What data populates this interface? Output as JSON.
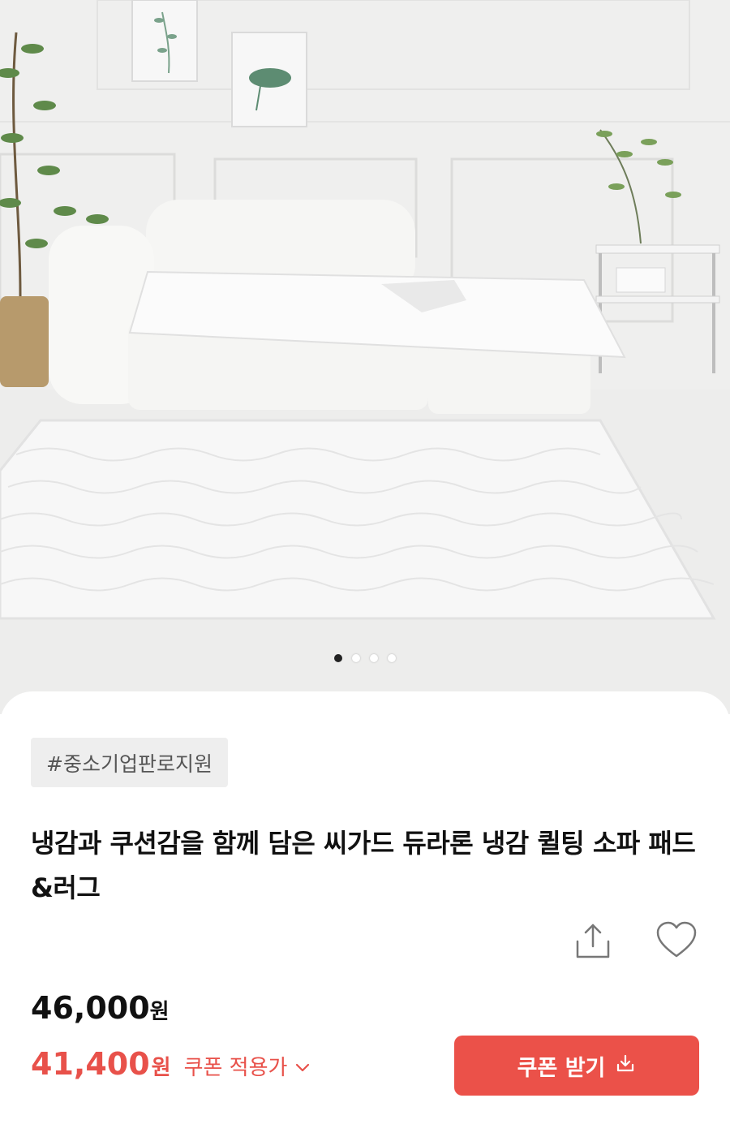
{
  "gallery": {
    "image_alt": "white quilted sofa pad and rug in living room",
    "page_count": 4,
    "active_index": 0
  },
  "product": {
    "tag": "#중소기업판로지원",
    "title": "냉감과 쿠션감을 함께 담은 씨가드 듀라론 냉감 퀼팅 소파 패드&러그",
    "price_original_number": "46,000",
    "price_original_unit": "원",
    "price_coupon_number": "41,400",
    "price_coupon_unit": "원",
    "coupon_note": "쿠폰 적용가"
  },
  "actions": {
    "coupon_button_label": "쿠폰 받기"
  },
  "icons": {
    "share": "share-icon",
    "like": "heart-icon",
    "chevron": "chevron-down-icon",
    "download": "download-icon"
  },
  "colors": {
    "accent": "#eb5149",
    "price_red": "#e8514a",
    "tag_bg": "#eeeeee"
  }
}
